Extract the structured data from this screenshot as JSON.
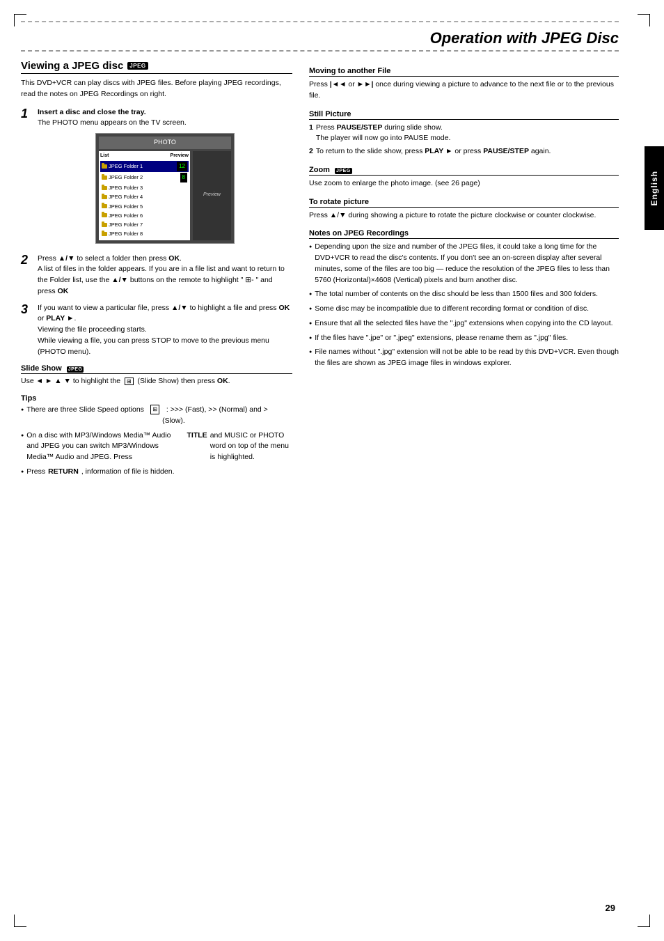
{
  "page": {
    "title": "Operation with JPEG Disc",
    "page_number": "29",
    "language_tab": "English"
  },
  "left_col": {
    "section_heading": "Viewing a JPEG disc",
    "jpeg_badge": "JPEG",
    "intro": "This DVD+VCR can play discs with JPEG files.  Before playing JPEG recordings, read the notes on JPEG Recordings on right.",
    "steps": [
      {
        "num": "1",
        "title": "Insert a disc and close the tray.",
        "body": "The PHOTO menu appears on the TV screen."
      },
      {
        "num": "2",
        "body": "Press ▲/▼ to select a folder then press OK. A list of files in the folder appears. If you are in a file list and want to return to the Folder list, use the ▲/▼ buttons on the remote to highlight \" ⊞- \" and press OK"
      },
      {
        "num": "3",
        "body": "If you want to view a particular file, press ▲/▼ to highlight a file and press OK or PLAY ►. Viewing the file proceeding starts. While viewing a file, you can press STOP to move to the previous menu (PHOTO menu)."
      }
    ],
    "slide_show": {
      "heading": "Slide Show",
      "jpeg_badge": "JPEG",
      "body": "Use ◄ ► ▲ ▼ to highlight the  ⊞  (Slide Show) then press OK."
    },
    "tips": {
      "heading": "Tips",
      "items": [
        "There are three Slide Speed options  ⊞  : >>> (Fast), >> (Normal) and > (Slow).",
        "On a disc with MP3/Windows Media™ Audio and JPEG you can switch MP3/Windows Media™ Audio and JPEG. Press TITLE and MUSIC or PHOTO word on top of the menu is highlighted.",
        "Press RETURN, information of file is hidden."
      ]
    },
    "photo_menu": {
      "title": "PHOTO",
      "list_label": "List",
      "preview_label": "Preview",
      "items": [
        "JPEG Folder 1",
        "JPEG Folder 2",
        "JPEG Folder 3",
        "JPEG Folder 4",
        "JPEG Folder 5",
        "JPEG Folder 6",
        "JPEG Folder 7",
        "JPEG Folder 8"
      ]
    }
  },
  "right_col": {
    "moving": {
      "heading": "Moving to another File",
      "body": "Press |◄◄ or ►►| once during viewing a picture to advance to the next file or to the previous file."
    },
    "still_picture": {
      "heading": "Still Picture",
      "step1": "Press PAUSE/STEP during slide show.",
      "step1_cont": "The player will now go into PAUSE mode.",
      "step2": "To return to the slide show, press PLAY ► or press PAUSE/STEP again."
    },
    "zoom": {
      "heading": "Zoom",
      "jpeg_badge": "JPEG",
      "body": "Use zoom to enlarge the photo image. (see 26 page)"
    },
    "rotate": {
      "heading": "To rotate picture",
      "body": "Press ▲/▼ during showing a picture to rotate the picture clockwise or counter clockwise."
    },
    "notes": {
      "heading": "Notes on JPEG Recordings",
      "items": [
        "Depending upon the size and number of the JPEG files, it could take a long time for the DVD+VCR to read the disc's contents. If you don't see an on-screen display after several minutes, some of the files are too big — reduce the resolution of the JPEG files to less than 5760 (Horizontal)×4608 (Vertical) pixels and burn another disc.",
        "The total number of contents on the disc should be less than 1500 files and 300 folders.",
        "Some disc may be incompatible due to different recording format or condition of disc.",
        "Ensure that all the selected files have the \".jpg\" extensions when copying into the CD layout.",
        "If the files have \".jpe\" or \".jpeg\" extensions, please rename them as \".jpg\" files.",
        "File names without \".jpg\" extension will not be able to be read by this DVD+VCR. Even though the files are shown as JPEG image files in windows explorer."
      ]
    }
  }
}
